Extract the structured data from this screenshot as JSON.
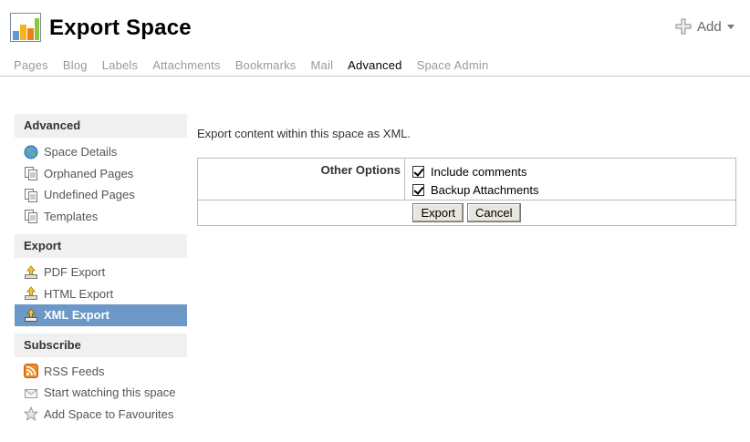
{
  "header": {
    "title": "Export Space",
    "add_label": "Add"
  },
  "tabs": [
    {
      "label": "Pages"
    },
    {
      "label": "Blog"
    },
    {
      "label": "Labels"
    },
    {
      "label": "Attachments"
    },
    {
      "label": "Bookmarks"
    },
    {
      "label": "Mail"
    },
    {
      "label": "Advanced",
      "active": true
    },
    {
      "label": "Space Admin"
    }
  ],
  "sidebar": {
    "sections": [
      {
        "title": "Advanced",
        "items": [
          {
            "label": "Space Details",
            "icon": "globe-icon"
          },
          {
            "label": "Orphaned Pages",
            "icon": "pages-icon"
          },
          {
            "label": "Undefined Pages",
            "icon": "pages-icon"
          },
          {
            "label": "Templates",
            "icon": "pages-icon"
          }
        ]
      },
      {
        "title": "Export",
        "items": [
          {
            "label": "PDF Export",
            "icon": "export-icon"
          },
          {
            "label": "HTML Export",
            "icon": "export-icon"
          },
          {
            "label": "XML Export",
            "icon": "export-icon",
            "active": true
          }
        ]
      },
      {
        "title": "Subscribe",
        "items": [
          {
            "label": "RSS Feeds",
            "icon": "rss-icon"
          },
          {
            "label": "Start watching this space",
            "icon": "envelope-icon"
          },
          {
            "label": "Add Space to Favourites",
            "icon": "star-icon"
          }
        ]
      }
    ]
  },
  "main": {
    "intro": "Export content within this space as XML.",
    "options_label": "Other Options",
    "options": [
      {
        "label": "Include comments",
        "checked": true
      },
      {
        "label": "Backup Attachments",
        "checked": true
      }
    ],
    "export_button": "Export",
    "cancel_button": "Cancel"
  },
  "colors": {
    "active_nav": "#6c98c8",
    "section_bg": "#f0f0f0"
  }
}
